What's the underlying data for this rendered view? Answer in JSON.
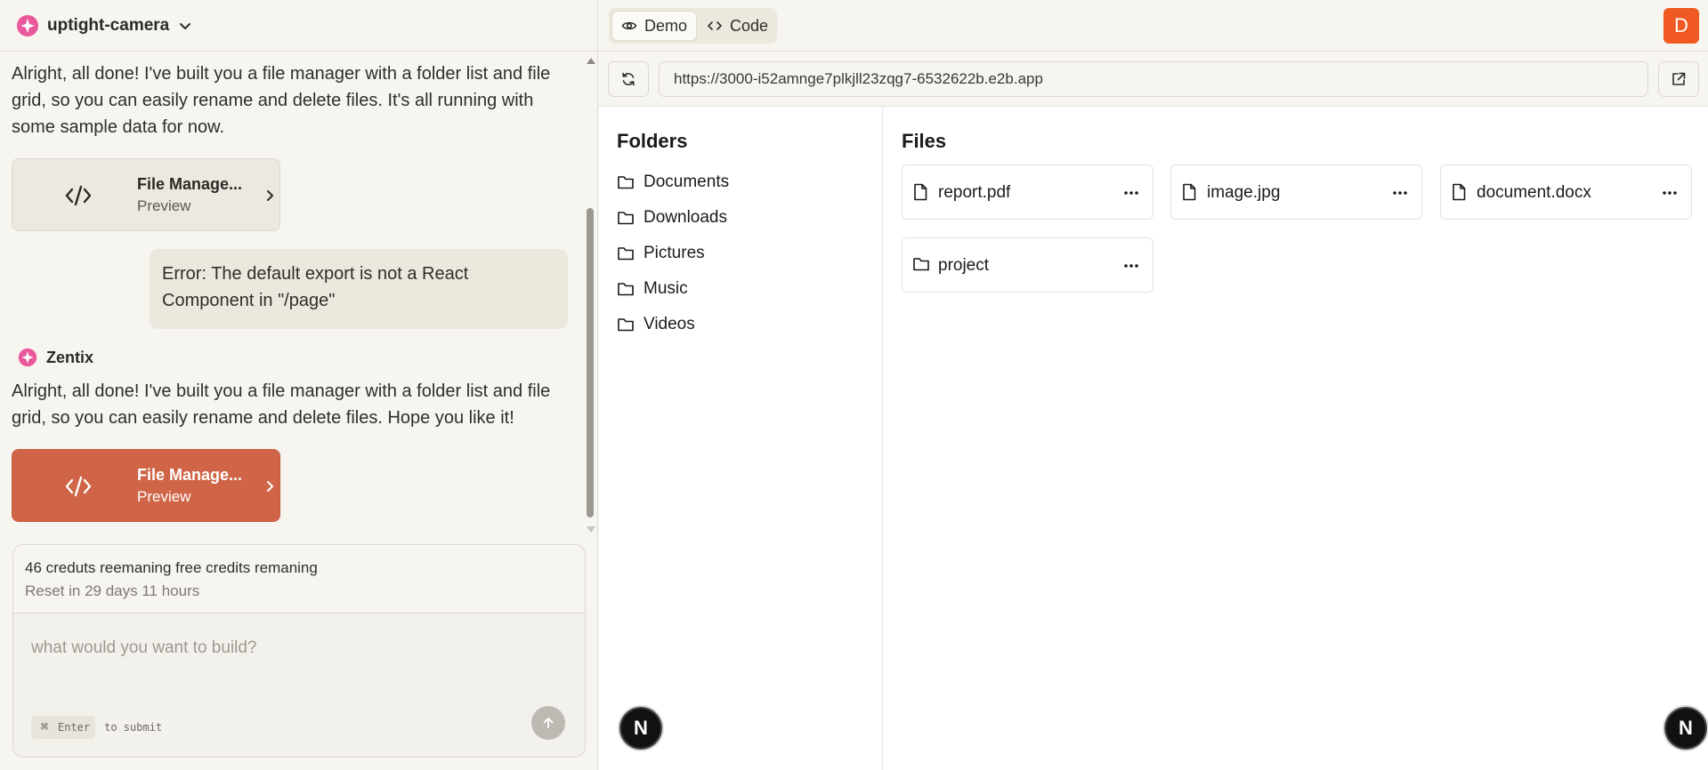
{
  "project": {
    "name": "uptight-camera",
    "logo_icon": "sparkle-logo-icon",
    "dropdown_icon": "chevron-down-icon"
  },
  "chat": {
    "messages": [
      {
        "role": "assistant",
        "text": "Alright, all done! I've built you a file manager with a folder list and file grid, so you can easily rename and delete files. It's all running with some sample data for now.",
        "card": {
          "title": "File Manage...",
          "subtitle": "Preview",
          "state": "neutral"
        }
      },
      {
        "role": "user",
        "text": "Error: The default export is not a React Component in \"/page\""
      },
      {
        "role": "assistant",
        "author": "Zentix",
        "text": "Alright, all done! I've built you a file manager with a folder list and file grid, so you can easily rename and delete files. Hope you like it!",
        "card": {
          "title": "File Manage...",
          "subtitle": "Preview",
          "state": "active"
        }
      }
    ]
  },
  "composer": {
    "credits_main": "46 creduts reemaning free credits remaning",
    "credits_reset": "Reset in 29 days 11 hours",
    "placeholder": "what would you want to build?",
    "hint_key": "⌘",
    "hint_enter": "Enter",
    "hint_text": "to submit"
  },
  "toolbar": {
    "demo_label": "Demo",
    "code_label": "Code",
    "avatar_letter": "D"
  },
  "urlbar": {
    "url": "https://3000-i52amnge7plkjll23zqg7-6532622b.e2b.app"
  },
  "app": {
    "folders_title": "Folders",
    "folders": [
      "Documents",
      "Downloads",
      "Pictures",
      "Music",
      "Videos"
    ],
    "files_title": "Files",
    "files": [
      {
        "name": "report.pdf",
        "kind": "file"
      },
      {
        "name": "image.jpg",
        "kind": "file"
      },
      {
        "name": "document.docx",
        "kind": "file"
      },
      {
        "name": "project",
        "kind": "folder"
      }
    ],
    "badge_letter": "N"
  },
  "colors": {
    "accent": "#cf6546",
    "avatar": "#f05a22",
    "logo_pink": "#e9589a"
  }
}
